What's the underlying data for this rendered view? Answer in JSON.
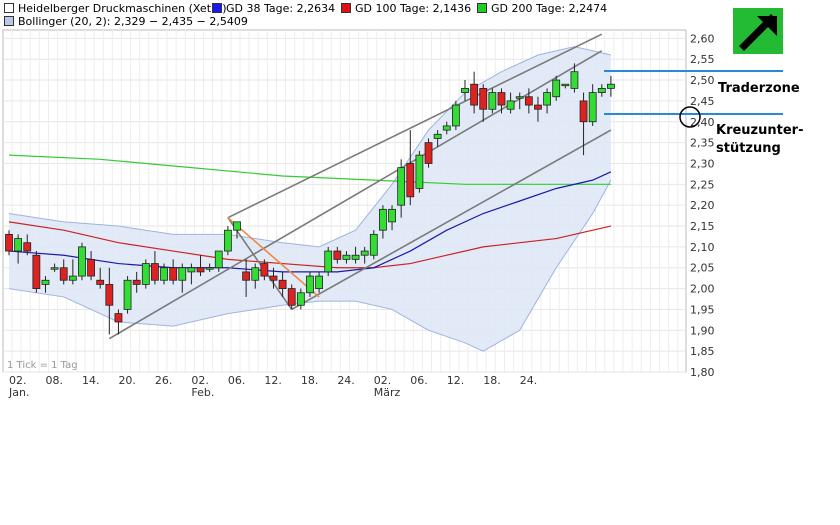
{
  "legend": {
    "main": "Heidelberger Druckmaschinen (Xetra)",
    "gd38": "GD 38 Tage: 2,2634",
    "gd100": "GD 100 Tage: 2,1436",
    "gd200": "GD 200 Tage: 2,2474",
    "bollinger": "Bollinger (20, 2): 2,329 − 2,435 − 2,5409"
  },
  "colors": {
    "up": "#33dd33",
    "down": "#dd2222",
    "gd38": "#1a1aaa",
    "gd100": "#cc2222",
    "gd200": "#33cc33",
    "bollinger_fill": "#dde6f7",
    "bollinger_line": "#9fb4dd",
    "trend": "#7a7a7a",
    "orange": "#ee8844",
    "zone": "#2a88d8",
    "arrow_bg": "#22bb33"
  },
  "tick_note": "1 Tick = 1 Tag",
  "annotations": {
    "traderzone": "Traderzone",
    "kreuz_line1": "Kreuzunter-",
    "kreuz_line2": "stützung"
  },
  "chart_data": {
    "type": "candlestick",
    "title": "Heidelberger Druckmaschinen (Xetra)",
    "ylim": [
      1.8,
      2.62
    ],
    "y_ticks": [
      "1,80",
      "1,85",
      "1,90",
      "1,95",
      "2,00",
      "2,05",
      "2,10",
      "2,15",
      "2,20",
      "2,25",
      "2,30",
      "2,35",
      "2,40",
      "2,45",
      "2,50",
      "2,55",
      "2,60"
    ],
    "x_ticks": [
      {
        "label": "02.",
        "sub": "Jan.",
        "i": 0
      },
      {
        "label": "08.",
        "sub": "",
        "i": 4
      },
      {
        "label": "14.",
        "sub": "",
        "i": 8
      },
      {
        "label": "20.",
        "sub": "",
        "i": 12
      },
      {
        "label": "26.",
        "sub": "",
        "i": 16
      },
      {
        "label": "02.",
        "sub": "Feb.",
        "i": 20
      },
      {
        "label": "06.",
        "sub": "",
        "i": 24
      },
      {
        "label": "12.",
        "sub": "",
        "i": 28
      },
      {
        "label": "18.",
        "sub": "",
        "i": 32
      },
      {
        "label": "24.",
        "sub": "",
        "i": 36
      },
      {
        "label": "02.",
        "sub": "März",
        "i": 40
      },
      {
        "label": "06.",
        "sub": "",
        "i": 44
      },
      {
        "label": "12.",
        "sub": "",
        "i": 48
      },
      {
        "label": "18.",
        "sub": "",
        "i": 52
      },
      {
        "label": "24.",
        "sub": "",
        "i": 56
      }
    ],
    "candles": [
      {
        "o": 2.13,
        "h": 2.14,
        "l": 2.08,
        "c": 2.09
      },
      {
        "o": 2.09,
        "h": 2.13,
        "l": 2.06,
        "c": 2.12
      },
      {
        "o": 2.11,
        "h": 2.13,
        "l": 2.08,
        "c": 2.09
      },
      {
        "o": 2.08,
        "h": 2.09,
        "l": 1.99,
        "c": 2.0
      },
      {
        "o": 2.01,
        "h": 2.03,
        "l": 1.99,
        "c": 2.02
      },
      {
        "o": 2.05,
        "h": 2.06,
        "l": 2.04,
        "c": 2.05
      },
      {
        "o": 2.05,
        "h": 2.07,
        "l": 2.01,
        "c": 2.02
      },
      {
        "o": 2.02,
        "h": 2.07,
        "l": 2.01,
        "c": 2.03
      },
      {
        "o": 2.03,
        "h": 2.11,
        "l": 2.02,
        "c": 2.1
      },
      {
        "o": 2.07,
        "h": 2.09,
        "l": 2.02,
        "c": 2.03
      },
      {
        "o": 2.02,
        "h": 2.05,
        "l": 2.0,
        "c": 2.01
      },
      {
        "o": 2.01,
        "h": 2.05,
        "l": 1.89,
        "c": 1.96
      },
      {
        "o": 1.94,
        "h": 1.95,
        "l": 1.89,
        "c": 1.92
      },
      {
        "o": 1.95,
        "h": 2.03,
        "l": 1.94,
        "c": 2.02
      },
      {
        "o": 2.02,
        "h": 2.04,
        "l": 1.99,
        "c": 2.01
      },
      {
        "o": 2.01,
        "h": 2.07,
        "l": 2.0,
        "c": 2.06
      },
      {
        "o": 2.06,
        "h": 2.09,
        "l": 2.01,
        "c": 2.02
      },
      {
        "o": 2.02,
        "h": 2.06,
        "l": 2.01,
        "c": 2.05
      },
      {
        "o": 2.05,
        "h": 2.07,
        "l": 2.01,
        "c": 2.02
      },
      {
        "o": 2.02,
        "h": 2.06,
        "l": 1.99,
        "c": 2.05
      },
      {
        "o": 2.04,
        "h": 2.06,
        "l": 2.01,
        "c": 2.05
      },
      {
        "o": 2.05,
        "h": 2.08,
        "l": 2.03,
        "c": 2.04
      },
      {
        "o": 2.05,
        "h": 2.06,
        "l": 2.04,
        "c": 2.05
      },
      {
        "o": 2.05,
        "h": 2.09,
        "l": 2.04,
        "c": 2.09
      },
      {
        "o": 2.09,
        "h": 2.15,
        "l": 2.08,
        "c": 2.14
      },
      {
        "o": 2.14,
        "h": 2.16,
        "l": 2.12,
        "c": 2.16
      },
      {
        "o": 2.04,
        "h": 2.07,
        "l": 1.98,
        "c": 2.02
      },
      {
        "o": 2.02,
        "h": 2.06,
        "l": 2.0,
        "c": 2.05
      },
      {
        "o": 2.06,
        "h": 2.07,
        "l": 2.02,
        "c": 2.03
      },
      {
        "o": 2.03,
        "h": 2.05,
        "l": 2.0,
        "c": 2.02
      },
      {
        "o": 2.02,
        "h": 2.04,
        "l": 1.98,
        "c": 2.0
      },
      {
        "o": 2.0,
        "h": 2.01,
        "l": 1.95,
        "c": 1.96
      },
      {
        "o": 1.96,
        "h": 2.0,
        "l": 1.95,
        "c": 1.99
      },
      {
        "o": 1.99,
        "h": 2.04,
        "l": 1.98,
        "c": 2.03
      },
      {
        "o": 2.0,
        "h": 2.04,
        "l": 1.99,
        "c": 2.03
      },
      {
        "o": 2.04,
        "h": 2.1,
        "l": 2.03,
        "c": 2.09
      },
      {
        "o": 2.09,
        "h": 2.1,
        "l": 2.06,
        "c": 2.07
      },
      {
        "o": 2.07,
        "h": 2.09,
        "l": 2.06,
        "c": 2.08
      },
      {
        "o": 2.07,
        "h": 2.1,
        "l": 2.06,
        "c": 2.08
      },
      {
        "o": 2.08,
        "h": 2.1,
        "l": 2.06,
        "c": 2.09
      },
      {
        "o": 2.08,
        "h": 2.14,
        "l": 2.07,
        "c": 2.13
      },
      {
        "o": 2.14,
        "h": 2.2,
        "l": 2.12,
        "c": 2.19
      },
      {
        "o": 2.16,
        "h": 2.2,
        "l": 2.14,
        "c": 2.19
      },
      {
        "o": 2.2,
        "h": 2.31,
        "l": 2.17,
        "c": 2.29
      },
      {
        "o": 2.3,
        "h": 2.38,
        "l": 2.2,
        "c": 2.22
      },
      {
        "o": 2.24,
        "h": 2.33,
        "l": 2.23,
        "c": 2.32
      },
      {
        "o": 2.35,
        "h": 2.36,
        "l": 2.29,
        "c": 2.3
      },
      {
        "o": 2.36,
        "h": 2.38,
        "l": 2.34,
        "c": 2.37
      },
      {
        "o": 2.38,
        "h": 2.4,
        "l": 2.37,
        "c": 2.39
      },
      {
        "o": 2.39,
        "h": 2.45,
        "l": 2.38,
        "c": 2.44
      },
      {
        "o": 2.47,
        "h": 2.5,
        "l": 2.45,
        "c": 2.48
      },
      {
        "o": 2.49,
        "h": 2.52,
        "l": 2.42,
        "c": 2.44
      },
      {
        "o": 2.48,
        "h": 2.49,
        "l": 2.4,
        "c": 2.43
      },
      {
        "o": 2.43,
        "h": 2.48,
        "l": 2.42,
        "c": 2.47
      },
      {
        "o": 2.47,
        "h": 2.48,
        "l": 2.42,
        "c": 2.44
      },
      {
        "o": 2.43,
        "h": 2.47,
        "l": 2.42,
        "c": 2.45
      },
      {
        "o": 2.46,
        "h": 2.47,
        "l": 2.43,
        "c": 2.46
      },
      {
        "o": 2.46,
        "h": 2.48,
        "l": 2.42,
        "c": 2.44
      },
      {
        "o": 2.44,
        "h": 2.46,
        "l": 2.4,
        "c": 2.43
      },
      {
        "o": 2.44,
        "h": 2.48,
        "l": 2.42,
        "c": 2.47
      },
      {
        "o": 2.46,
        "h": 2.51,
        "l": 2.45,
        "c": 2.5
      },
      {
        "o": 2.49,
        "h": 2.49,
        "l": 2.48,
        "c": 2.49
      },
      {
        "o": 2.48,
        "h": 2.54,
        "l": 2.47,
        "c": 2.52
      },
      {
        "o": 2.45,
        "h": 2.47,
        "l": 2.32,
        "c": 2.4
      },
      {
        "o": 2.4,
        "h": 2.49,
        "l": 2.39,
        "c": 2.47
      },
      {
        "o": 2.47,
        "h": 2.49,
        "l": 2.46,
        "c": 2.48
      },
      {
        "o": 2.48,
        "h": 2.51,
        "l": 2.46,
        "c": 2.49
      }
    ],
    "gd38": [
      [
        0,
        2.09
      ],
      [
        6,
        2.08
      ],
      [
        12,
        2.06
      ],
      [
        18,
        2.05
      ],
      [
        24,
        2.05
      ],
      [
        30,
        2.04
      ],
      [
        36,
        2.04
      ],
      [
        40,
        2.05
      ],
      [
        44,
        2.09
      ],
      [
        48,
        2.14
      ],
      [
        52,
        2.18
      ],
      [
        56,
        2.21
      ],
      [
        60,
        2.24
      ],
      [
        64,
        2.26
      ],
      [
        66,
        2.28
      ]
    ],
    "gd100": [
      [
        0,
        2.16
      ],
      [
        6,
        2.14
      ],
      [
        12,
        2.11
      ],
      [
        18,
        2.09
      ],
      [
        24,
        2.07
      ],
      [
        30,
        2.06
      ],
      [
        36,
        2.05
      ],
      [
        40,
        2.05
      ],
      [
        44,
        2.06
      ],
      [
        48,
        2.08
      ],
      [
        52,
        2.1
      ],
      [
        56,
        2.11
      ],
      [
        60,
        2.12
      ],
      [
        64,
        2.14
      ],
      [
        66,
        2.15
      ]
    ],
    "gd200": [
      [
        0,
        2.32
      ],
      [
        10,
        2.31
      ],
      [
        20,
        2.29
      ],
      [
        30,
        2.27
      ],
      [
        40,
        2.26
      ],
      [
        50,
        2.25
      ],
      [
        60,
        2.25
      ],
      [
        66,
        2.25
      ]
    ],
    "bollinger_upper": [
      [
        0,
        2.18
      ],
      [
        6,
        2.16
      ],
      [
        12,
        2.15
      ],
      [
        18,
        2.13
      ],
      [
        24,
        2.13
      ],
      [
        30,
        2.11
      ],
      [
        34,
        2.1
      ],
      [
        38,
        2.14
      ],
      [
        42,
        2.25
      ],
      [
        46,
        2.38
      ],
      [
        50,
        2.47
      ],
      [
        54,
        2.52
      ],
      [
        58,
        2.56
      ],
      [
        62,
        2.58
      ],
      [
        66,
        2.56
      ]
    ],
    "bollinger_lower": [
      [
        0,
        2.0
      ],
      [
        6,
        1.98
      ],
      [
        12,
        1.92
      ],
      [
        18,
        1.91
      ],
      [
        24,
        1.94
      ],
      [
        30,
        1.96
      ],
      [
        34,
        1.97
      ],
      [
        38,
        1.97
      ],
      [
        42,
        1.95
      ],
      [
        46,
        1.9
      ],
      [
        50,
        1.87
      ],
      [
        52,
        1.85
      ],
      [
        56,
        1.9
      ],
      [
        60,
        2.05
      ],
      [
        64,
        2.18
      ],
      [
        66,
        2.26
      ]
    ],
    "trend_lines": [
      {
        "from": [
          11,
          1.88
        ],
        "to": [
          65,
          2.57
        ],
        "color": "trend"
      },
      {
        "from": [
          24,
          2.17
        ],
        "to": [
          65,
          2.61
        ],
        "color": "trend"
      },
      {
        "from": [
          31,
          1.95
        ],
        "to": [
          66,
          2.38
        ],
        "color": "trend"
      },
      {
        "from": [
          24,
          2.17
        ],
        "to": [
          31,
          1.95
        ],
        "color": "trend"
      },
      {
        "from": [
          24,
          2.17
        ],
        "to": [
          34,
          1.98
        ],
        "color": "orange"
      }
    ],
    "zone_lines": [
      2.52,
      2.4
    ]
  }
}
